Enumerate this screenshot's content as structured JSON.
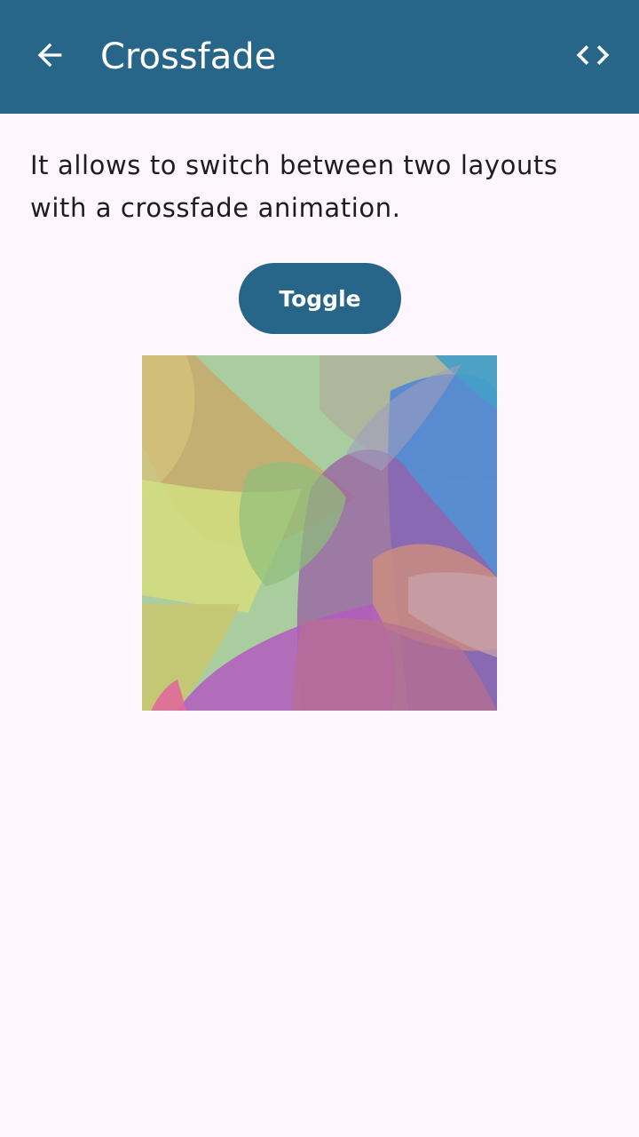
{
  "app_bar": {
    "title": "Crossfade",
    "back_icon": "arrow-back-icon",
    "code_icon": "code-icon",
    "background_color": "#286689"
  },
  "content": {
    "description": "It allows to switch between two layouts with a crossfade animation.",
    "toggle_label": "Toggle"
  },
  "colors": {
    "background": "#FDF7FD",
    "primary": "#286689",
    "text": "#1F1B22"
  }
}
